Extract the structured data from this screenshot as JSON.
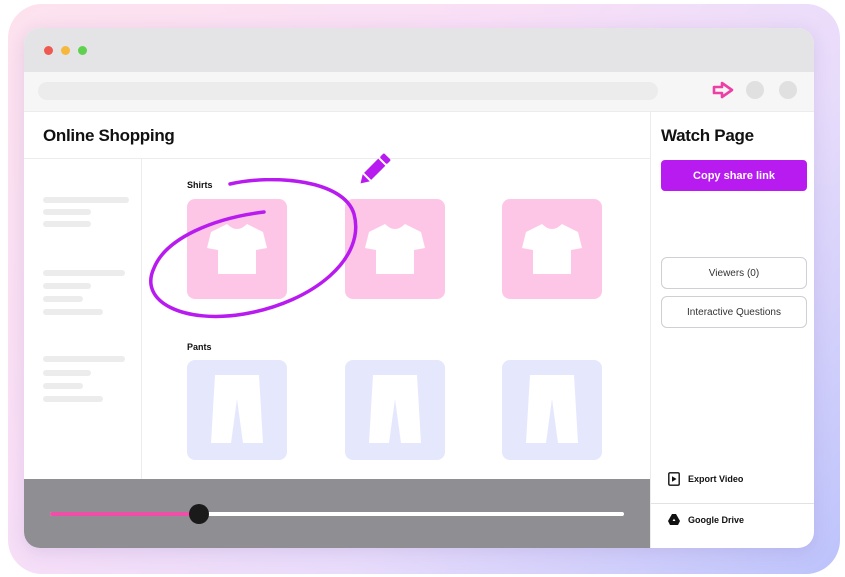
{
  "window": {
    "traffic_lights": [
      "#ee5a52",
      "#f5b83d",
      "#5ed14f"
    ]
  },
  "app": {
    "title": "Online Shopping"
  },
  "catalog": {
    "sections": [
      {
        "label": "Shirts",
        "item_icon": "tshirt-icon",
        "count": 3
      },
      {
        "label": "Pants",
        "item_icon": "pants-icon",
        "count": 3
      }
    ]
  },
  "annotation": {
    "color": "#b81bef",
    "tool_icon": "pencil-icon"
  },
  "player": {
    "progress": 0.26,
    "fill_color": "#ee4fa7"
  },
  "side_panel": {
    "title": "Watch Page",
    "copy_button": "Copy share link",
    "viewers_button": "Viewers (0)",
    "questions_button": "Interactive Questions",
    "export_label": "Export Video",
    "drive_label": "Google Drive"
  },
  "colors": {
    "accent": "#b81bef",
    "shirt_tile": "#fec6e6",
    "pant_tile": "#e5e7fd"
  }
}
